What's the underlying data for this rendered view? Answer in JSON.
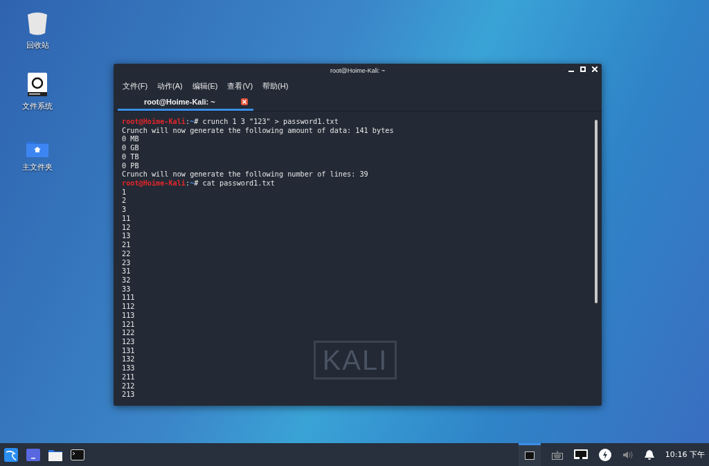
{
  "desktop_icons": [
    {
      "kind": "trash",
      "label": "回收站"
    },
    {
      "kind": "drive",
      "label": "文件系统"
    },
    {
      "kind": "home",
      "label": "主文件夹"
    }
  ],
  "window": {
    "title": "root@Hoime-Kali: ~",
    "menu": [
      "文件(F)",
      "动作(A)",
      "编辑(E)",
      "查看(V)",
      "帮助(H)"
    ],
    "tabs": [
      {
        "label": "root@Hoime-Kali: ~",
        "selected": true
      }
    ],
    "background_logo": "KALI",
    "lines": [
      {
        "kind": "prompt",
        "user_host": "root@Hoime-Kali",
        "separator": ":",
        "path": "~",
        "command": "# crunch 1 3 \"123\" > password1.txt"
      },
      {
        "kind": "output",
        "text": "Crunch will now generate the following amount of data: 141 bytes"
      },
      {
        "kind": "output",
        "text": "0 MB"
      },
      {
        "kind": "output",
        "text": "0 GB"
      },
      {
        "kind": "output",
        "text": "0 TB"
      },
      {
        "kind": "output",
        "text": "0 PB"
      },
      {
        "kind": "output",
        "text": "Crunch will now generate the following number of lines: 39"
      },
      {
        "kind": "prompt",
        "user_host": "root@Hoime-Kali",
        "separator": ":",
        "path": "~",
        "command": "# cat password1.txt"
      },
      {
        "kind": "output",
        "text": "1"
      },
      {
        "kind": "output",
        "text": "2"
      },
      {
        "kind": "output",
        "text": "3"
      },
      {
        "kind": "output",
        "text": "11"
      },
      {
        "kind": "output",
        "text": "12"
      },
      {
        "kind": "output",
        "text": "13"
      },
      {
        "kind": "output",
        "text": "21"
      },
      {
        "kind": "output",
        "text": "22"
      },
      {
        "kind": "output",
        "text": "23"
      },
      {
        "kind": "output",
        "text": "31"
      },
      {
        "kind": "output",
        "text": "32"
      },
      {
        "kind": "output",
        "text": "33"
      },
      {
        "kind": "output",
        "text": "111"
      },
      {
        "kind": "output",
        "text": "112"
      },
      {
        "kind": "output",
        "text": "113"
      },
      {
        "kind": "output",
        "text": "121"
      },
      {
        "kind": "output",
        "text": "122"
      },
      {
        "kind": "output",
        "text": "123"
      },
      {
        "kind": "output",
        "text": "131"
      },
      {
        "kind": "output",
        "text": "132"
      },
      {
        "kind": "output",
        "text": "133"
      },
      {
        "kind": "output",
        "text": "211"
      },
      {
        "kind": "output",
        "text": "212"
      },
      {
        "kind": "output",
        "text": "213"
      }
    ]
  },
  "taskbar": {
    "launchers": [
      {
        "kind": "kali"
      },
      {
        "kind": "desktop"
      },
      {
        "kind": "folder"
      },
      {
        "kind": "terminal"
      }
    ],
    "tasks": [
      {
        "kind": "terminal",
        "selected": true
      }
    ],
    "tray": [
      {
        "kind": "keyboard"
      },
      {
        "kind": "network"
      },
      {
        "kind": "power"
      },
      {
        "kind": "volume"
      },
      {
        "kind": "bell"
      }
    ],
    "clock": "10:16 下午"
  }
}
